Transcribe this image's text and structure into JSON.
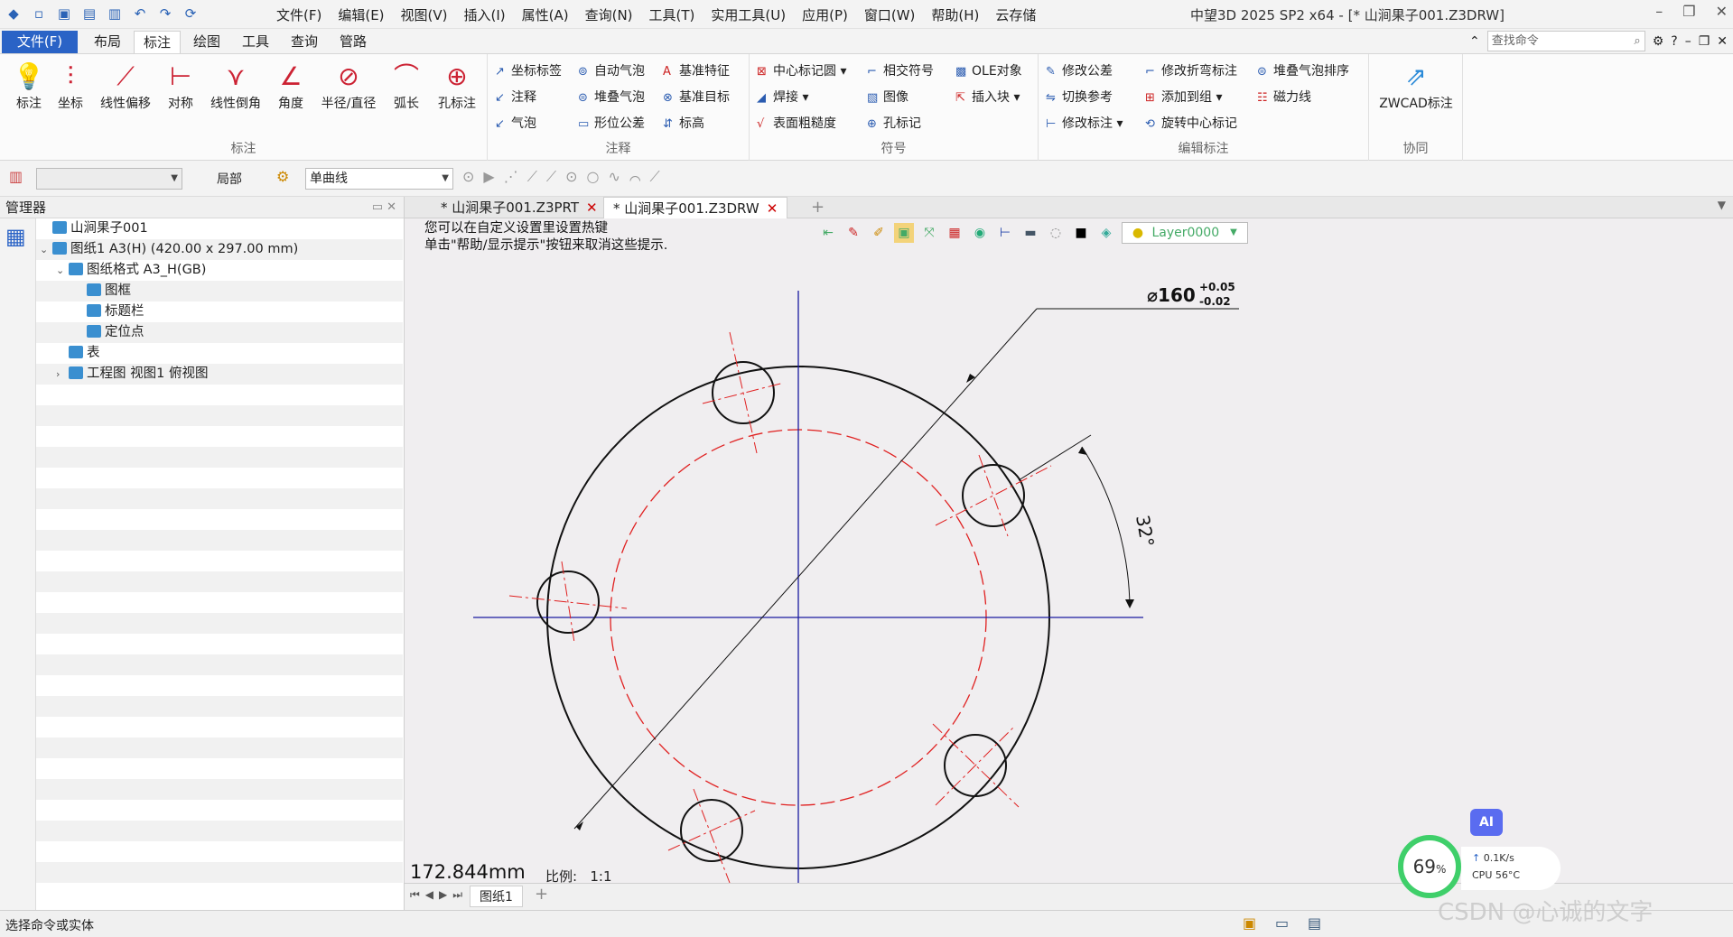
{
  "app": {
    "window_title": "中望3D 2025 SP2 x64 - [* 山涧果子001.Z3DRW]",
    "menus": [
      "文件(F)",
      "编辑(E)",
      "视图(V)",
      "插入(I)",
      "属性(A)",
      "查询(N)",
      "工具(T)",
      "实用工具(U)",
      "应用(P)",
      "窗口(W)",
      "帮助(H)",
      "云存储"
    ]
  },
  "ribbon_tabs": [
    "文件(F)",
    "布局",
    "标注",
    "绘图",
    "工具",
    "查询",
    "管路"
  ],
  "search_placeholder": "查找命令",
  "ribbon": {
    "dimension_group": {
      "label": "标注",
      "buttons": [
        "标注",
        "坐标",
        "线性偏移",
        "对称",
        "线性倒角",
        "角度",
        "半径/直径",
        "弧长",
        "孔标注"
      ]
    },
    "annotation_group": {
      "label": "注释",
      "buttons": [
        "坐标标签",
        "注释",
        "气泡",
        "自动气泡",
        "堆叠气泡",
        "形位公差",
        "基准特征",
        "基准目标",
        "标高"
      ]
    },
    "symbol_group": {
      "label": "符号",
      "buttons": [
        "中心标记圆",
        "焊接",
        "表面粗糙度",
        "相交符号",
        "图像",
        "孔标记",
        "OLE对象",
        "插入块"
      ]
    },
    "edit_group": {
      "label": "编辑标注",
      "buttons": [
        "修改公差",
        "切换参考",
        "修改标注",
        "修改折弯标注",
        "添加到组",
        "旋转中心标记",
        "堆叠气泡排序",
        "磁力线"
      ]
    },
    "collab_group": {
      "label": "协同",
      "buttons": [
        "ZWCAD标注"
      ]
    }
  },
  "toolbar2": {
    "scope_label": "局部",
    "line_type": "单曲线"
  },
  "manager": {
    "title": "管理器",
    "tree": [
      {
        "label": "山涧果子001",
        "level": 0
      },
      {
        "label": "图纸1 A3(H) (420.00 x 297.00 mm)",
        "level": 0
      },
      {
        "label": "图纸格式 A3_H(GB)",
        "level": 1
      },
      {
        "label": "图框",
        "level": 2
      },
      {
        "label": "标题栏",
        "level": 2
      },
      {
        "label": "定位点",
        "level": 2
      },
      {
        "label": "表",
        "level": 1
      },
      {
        "label": "工程图 视图1 俯视图",
        "level": 1
      }
    ]
  },
  "doc_tabs": [
    "* 山涧果子001.Z3PRT",
    "* 山涧果子001.Z3DRW"
  ],
  "canvas": {
    "hint_line1": "您可以在自定义设置里设置热键",
    "hint_line2": "单击\"帮助/显示提示\"按钮来取消这些提示.",
    "layer": "Layer0000",
    "dim_diameter": "⌀160",
    "tol_upper": "+0.05",
    "tol_lower": "-0.02",
    "angle_text": "32°",
    "measure": "172.844mm",
    "scale_label": "比例:",
    "scale_value": "1:1"
  },
  "sheet_tab": "图纸1",
  "status": {
    "text": "选择命令或实体",
    "cpu_percent": "69",
    "net_speed": "0.1K/s",
    "cpu_temp": "CPU 56°C",
    "ai_label": "AI",
    "watermark": "CSDN @心诚的文字"
  },
  "colors": {
    "accent": "#2a63c6",
    "centerline": "#1a1aa0",
    "pitch_circle": "#e02020"
  }
}
